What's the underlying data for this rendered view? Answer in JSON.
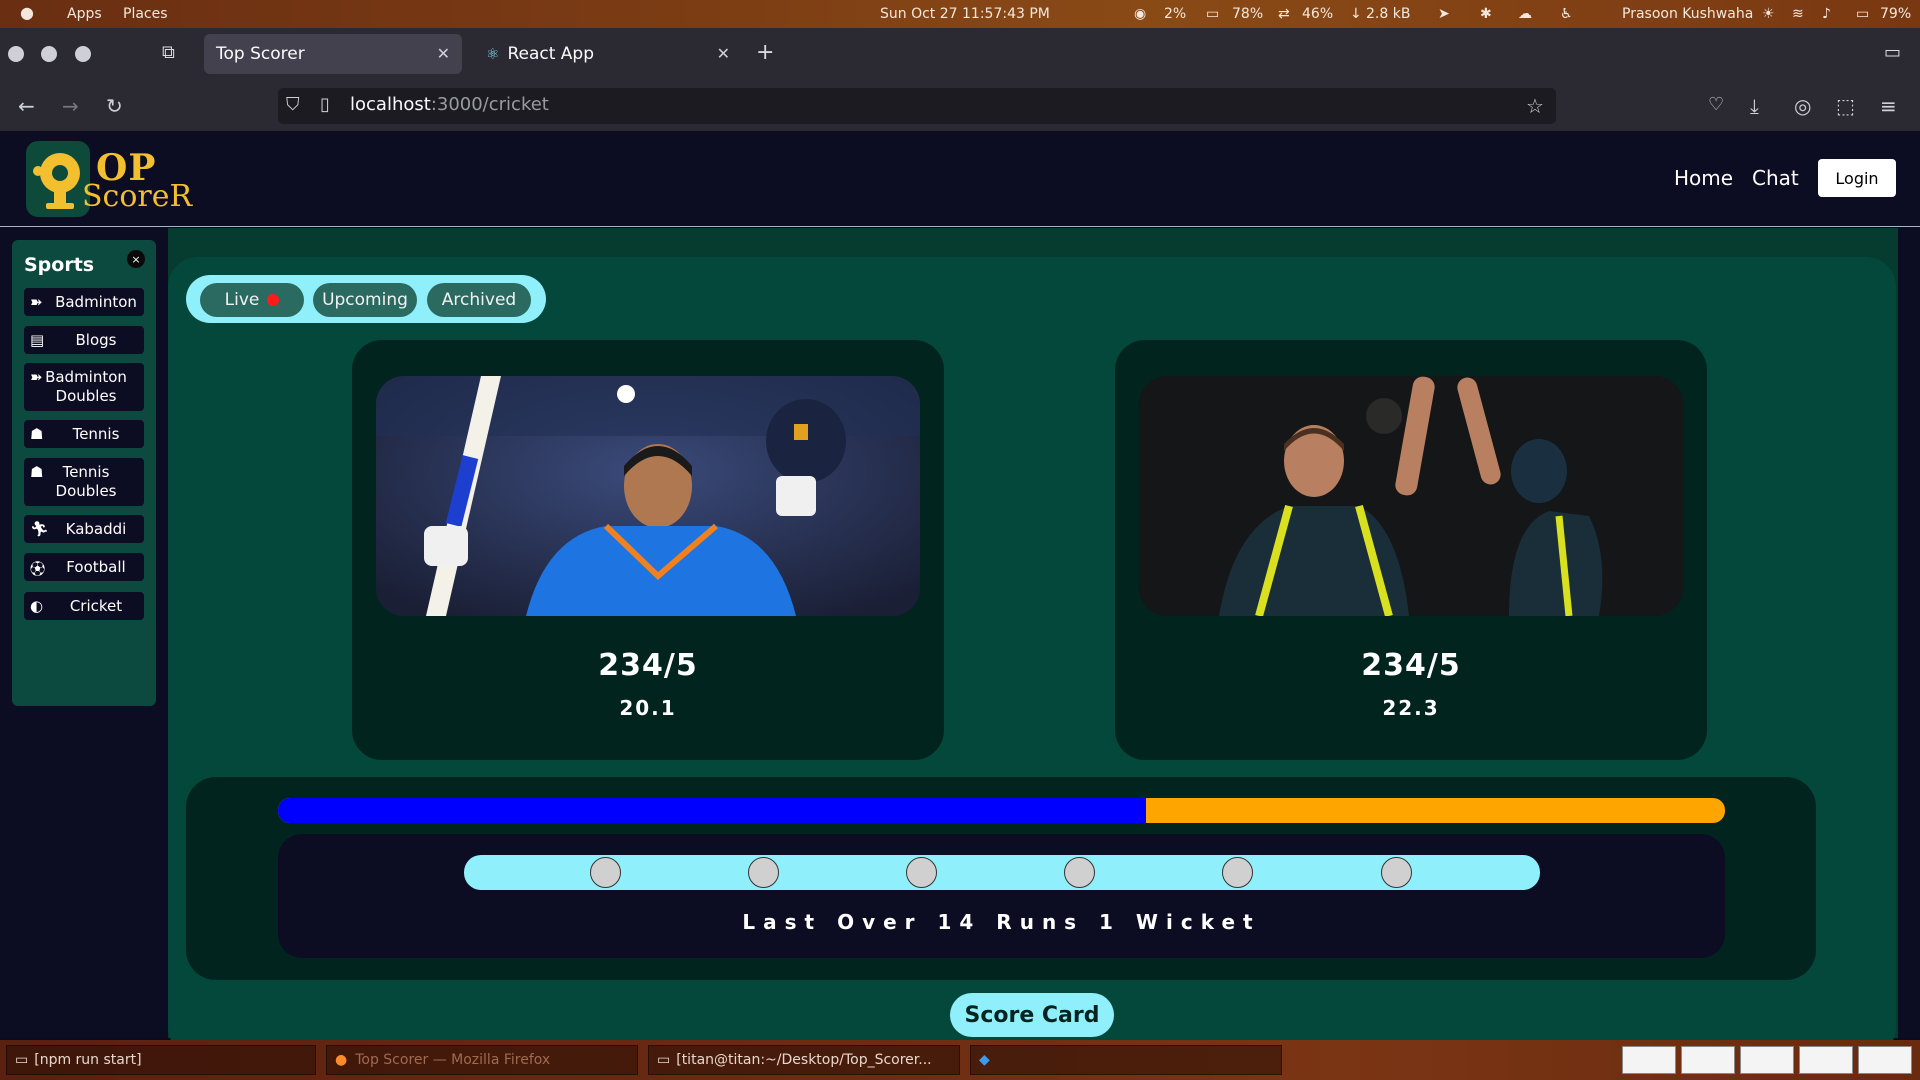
{
  "system_bar": {
    "apps": "Apps",
    "places": "Places",
    "datetime": "Sun Oct 27  11:57:43 PM",
    "cpu": "2%",
    "battery_alt": "78%",
    "net": "46%",
    "download": "2.8 kB",
    "user": "Prasoon Kushwaha",
    "battery": "79%"
  },
  "browser": {
    "tabs": [
      {
        "label": "Top Scorer",
        "active": true
      },
      {
        "label": "React App",
        "active": false
      }
    ],
    "url_host": "localhost",
    "url_rest": ":3000/cricket"
  },
  "header": {
    "logo_top": "OP",
    "logo_bottom": "ScoreR",
    "nav": [
      "Home",
      "Chat"
    ],
    "login": "Login"
  },
  "sidebar": {
    "title": "Sports",
    "close": "×",
    "items": [
      {
        "label": "Badminton",
        "icon": "badminton-icon"
      },
      {
        "label": "Blogs",
        "icon": "blogs-icon"
      },
      {
        "label": "Badminton Doubles",
        "icon": "badminton-icon"
      },
      {
        "label": "Tennis",
        "icon": "tennis-icon"
      },
      {
        "label": "Tennis Doubles",
        "icon": "tennis-icon"
      },
      {
        "label": "Kabaddi",
        "icon": "kabaddi-icon"
      },
      {
        "label": "Football",
        "icon": "football-icon"
      },
      {
        "label": "Cricket",
        "icon": "cricket-icon"
      }
    ]
  },
  "status_tabs": [
    "Live",
    "Upcoming",
    "Archived"
  ],
  "teams": [
    {
      "score": "234/5",
      "overs": "20.1",
      "image": "india-batter-photo"
    },
    {
      "score": "234/5",
      "overs": "22.3",
      "image": "australia-bowlers-photo"
    }
  ],
  "progress": {
    "team1_fraction": 0.6,
    "team1_color": "#0000ff",
    "team2_color": "#ffa500"
  },
  "last_over": {
    "balls": 6,
    "text": "Last Over 14 Runs 1 Wicket"
  },
  "scorecard_label": "Score Card",
  "taskbar": {
    "items": [
      "[npm run start]",
      "Top Scorer — Mozilla Firefox",
      "[titan@titan:~/Desktop/Top_Scorer..."
    ]
  },
  "colors": {
    "accent": "#8ff0fb",
    "panel": "#04473b",
    "dark": "#0c0c22"
  }
}
